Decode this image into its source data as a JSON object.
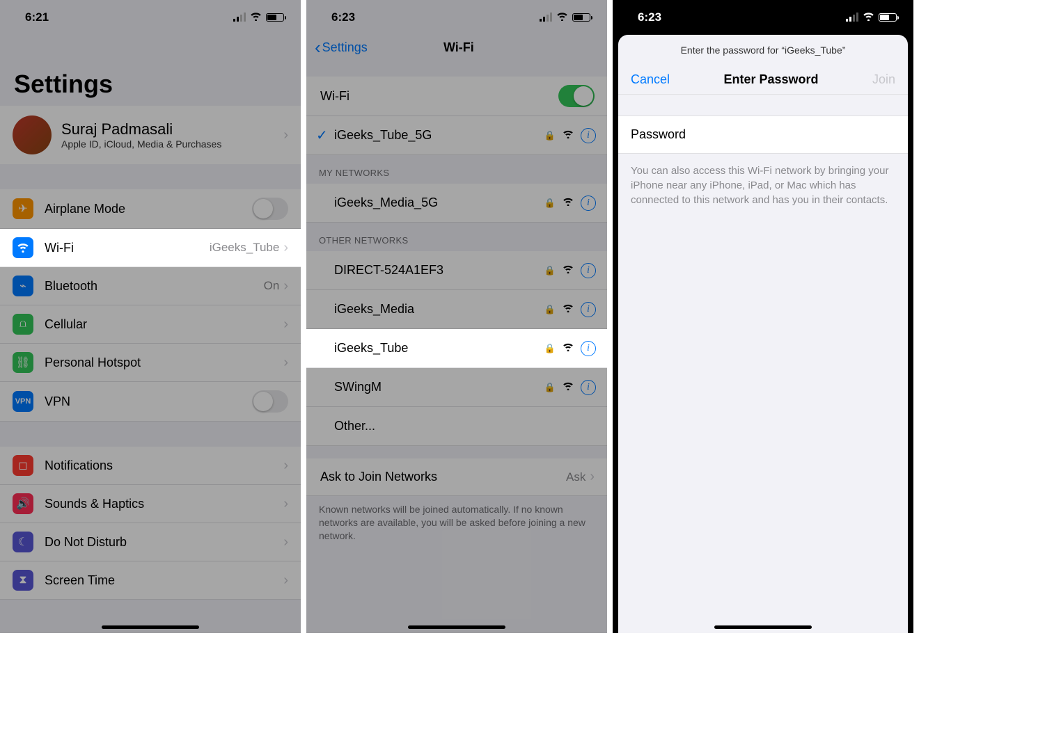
{
  "screen1": {
    "time": "6:21",
    "title": "Settings",
    "profile": {
      "name": "Suraj Padmasali",
      "sub": "Apple ID, iCloud, Media & Purchases"
    },
    "rows": {
      "airplane": "Airplane Mode",
      "wifi": "Wi-Fi",
      "wifi_value": "iGeeks_Tube",
      "bluetooth": "Bluetooth",
      "bluetooth_value": "On",
      "cellular": "Cellular",
      "hotspot": "Personal Hotspot",
      "vpn": "VPN",
      "notifications": "Notifications",
      "sounds": "Sounds & Haptics",
      "dnd": "Do Not Disturb",
      "screentime": "Screen Time"
    }
  },
  "screen2": {
    "time": "6:23",
    "back": "Settings",
    "title": "Wi-Fi",
    "wifi_label": "Wi-Fi",
    "connected": "iGeeks_Tube_5G",
    "my_header": "MY NETWORKS",
    "my_networks": [
      "iGeeks_Media_5G"
    ],
    "other_header": "OTHER NETWORKS",
    "other_networks": [
      "DIRECT-524A1EF3",
      "iGeeks_Media",
      "iGeeks_Tube",
      "SWingM"
    ],
    "other_label": "Other...",
    "ask_label": "Ask to Join Networks",
    "ask_value": "Ask",
    "footer": "Known networks will be joined automatically. If no known networks are available, you will be asked before joining a new network."
  },
  "screen3": {
    "time": "6:23",
    "prompt": "Enter the password for “iGeeks_Tube”",
    "cancel": "Cancel",
    "title": "Enter Password",
    "join": "Join",
    "password_label": "Password",
    "hint": "You can also access this Wi-Fi network by bringing your iPhone near any iPhone, iPad, or Mac which has connected to this network and has you in their contacts."
  }
}
